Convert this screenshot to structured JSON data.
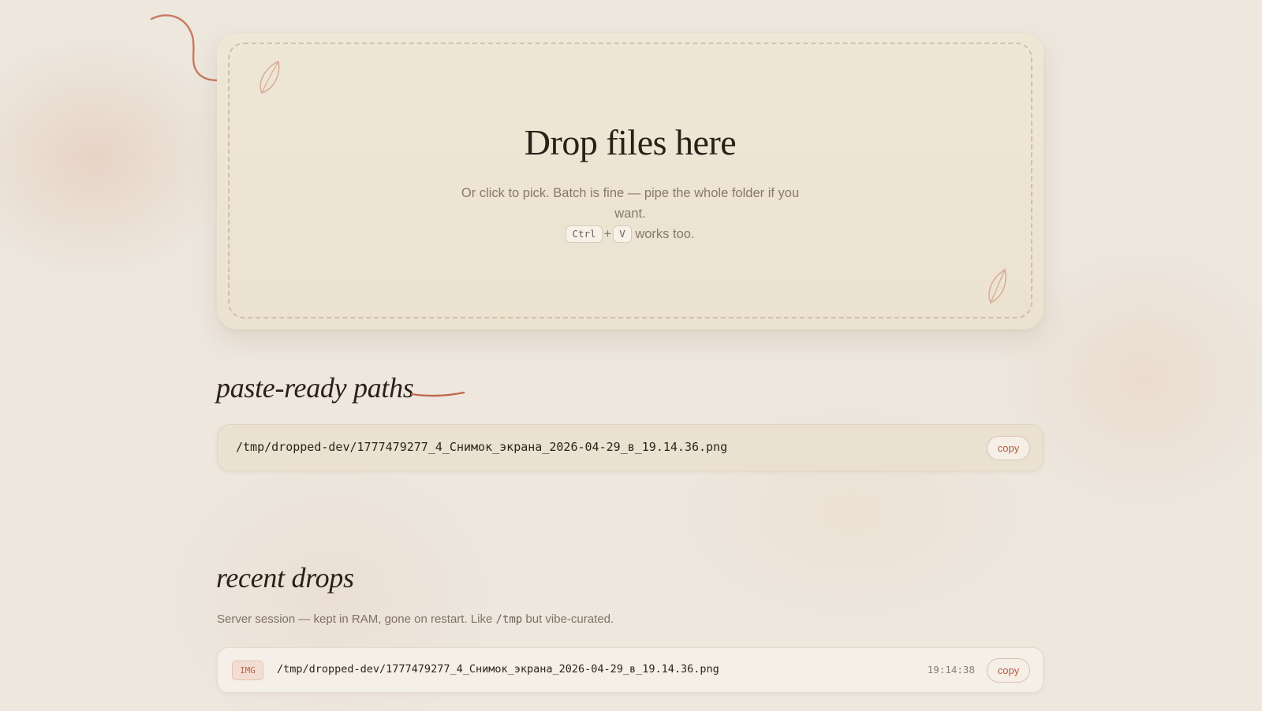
{
  "dropzone": {
    "title": "Drop files here",
    "subtitle": "Or click to pick. Batch is fine — pipe the whole folder if you want.",
    "shortcut_key_1": "Ctrl",
    "shortcut_plus": "+",
    "shortcut_key_2": "V",
    "shortcut_suffix": "works too."
  },
  "paths_section": {
    "title": "paste-ready paths",
    "items": [
      {
        "path": "/tmp/dropped-dev/1777479277_4_Снимок_экрана_2026-04-29_в_19.14.36.png",
        "copy_label": "copy"
      }
    ]
  },
  "recent_section": {
    "title": "recent drops",
    "description_prefix": "Server session — kept in RAM, gone on restart. Like",
    "description_code": "/tmp",
    "description_suffix": "but vibe-curated.",
    "items": [
      {
        "badge": "IMG",
        "path": "/tmp/dropped-dev/1777479277_4_Снимок_экрана_2026-04-29_в_19.14.36.png",
        "time": "19:14:38",
        "copy_label": "copy"
      }
    ]
  },
  "colors": {
    "background": "#ede7de",
    "accent": "#b45a42",
    "dropzone_bg": "#efe7d6",
    "text_dark": "#2b2018",
    "text_muted": "#86796d"
  },
  "icons": {
    "curl": "decorative-curl-line",
    "leaf": "leaf-icon",
    "swoosh": "underline-swoosh"
  }
}
